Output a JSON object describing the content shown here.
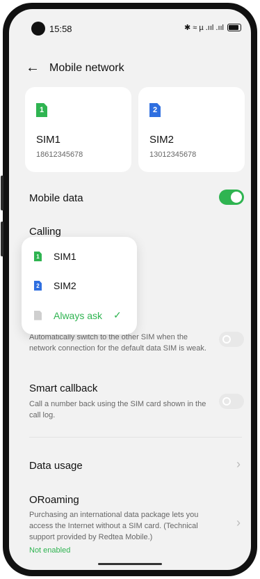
{
  "status": {
    "time": "15:58",
    "signal_text": "✱ ≈ µ .ııl .ııl"
  },
  "header": {
    "back_icon": "←",
    "title": "Mobile network"
  },
  "sim_cards": [
    {
      "badge": "1",
      "name": "SIM1",
      "number": "18612345678",
      "color": "#2fb451"
    },
    {
      "badge": "2",
      "name": "SIM2",
      "number": "13012345678",
      "color": "#2f6fe0"
    }
  ],
  "mobile_data": {
    "label": "Mobile data",
    "enabled": true
  },
  "calling": {
    "label": "Calling"
  },
  "calling_popup": {
    "options": [
      {
        "badge": "1",
        "label": "SIM1",
        "color": "#2fb451",
        "selected": false
      },
      {
        "badge": "2",
        "label": "SIM2",
        "color": "#2f6fe0",
        "selected": false
      },
      {
        "badge": "",
        "label": "Always ask",
        "color": "#cfcfcf",
        "selected": true
      }
    ],
    "check_icon": "✓"
  },
  "auto_switch": {
    "description": "Automatically switch to the other SIM when the network connection for the default data SIM is weak.",
    "enabled": false
  },
  "smart_callback": {
    "label": "Smart callback",
    "description": "Call a number back using the SIM card shown in the call log.",
    "enabled": false
  },
  "data_usage": {
    "label": "Data usage",
    "chevron": "›"
  },
  "oroaming": {
    "label": "ORoaming",
    "description": "Purchasing an international data package lets you access the Internet without a SIM card. (Technical support provided by Redtea Mobile.)",
    "status": "Not enabled",
    "chevron": "›"
  },
  "colors": {
    "accent": "#2fb451",
    "sim2": "#2f6fe0",
    "background": "#f2f2f2"
  }
}
